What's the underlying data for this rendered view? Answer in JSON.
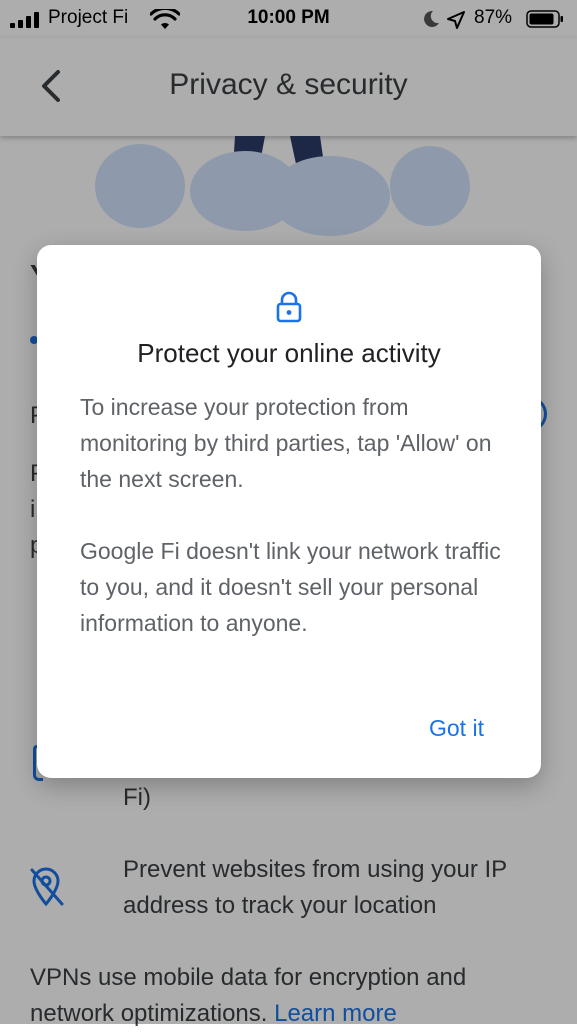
{
  "status_bar": {
    "carrier": "Project Fi",
    "time": "10:00 PM",
    "battery": "87%"
  },
  "app_bar": {
    "title": "Privacy & security"
  },
  "background": {
    "partial_letter_y": "Y",
    "partial_letter_p1": "P",
    "partial_letter_p2": "P",
    "partial_letter_i": "i",
    "partial_letter_p3": "p",
    "wrap_text": "Fi)",
    "feature_text": "Prevent websites from using your IP address to track your location",
    "footer_text": "VPNs use mobile data for encryption and network optimizations.",
    "learn_more": "Learn more"
  },
  "dialog": {
    "icon": "lock-icon",
    "title": "Protect your online activity",
    "paragraph1": "To increase your protection from monitoring by third parties, tap 'Allow' on the next screen.",
    "paragraph2": "Google Fi doesn't link your network traffic to you, and it doesn't sell your personal information to anyone.",
    "button": "Got it"
  },
  "colors": {
    "accent": "#1a73e8",
    "scrim": "rgba(0,0,0,0.32)",
    "illustration_dark": "#2b3a67",
    "illustration_light": "#d2e3fc"
  }
}
